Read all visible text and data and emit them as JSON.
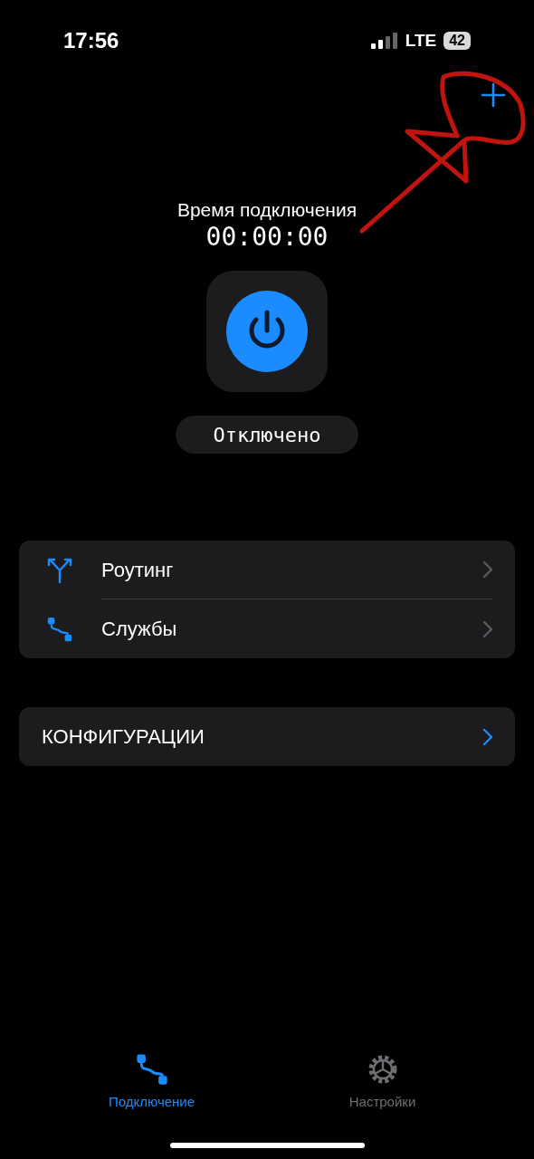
{
  "status_bar": {
    "time": "17:56",
    "network": "LTE",
    "battery": "42"
  },
  "connection": {
    "label": "Время подключения",
    "timer": "00:00:00",
    "status": "Отключено"
  },
  "menu": [
    {
      "label": "Роутинг",
      "kind": "routing"
    },
    {
      "label": "Службы",
      "kind": "services"
    }
  ],
  "configurations": {
    "label": "КОНФИГУРАЦИИ"
  },
  "tabs": [
    {
      "label": "Подключение",
      "kind": "connection",
      "selected": true
    },
    {
      "label": "Настройки",
      "kind": "settings",
      "selected": false
    }
  ]
}
